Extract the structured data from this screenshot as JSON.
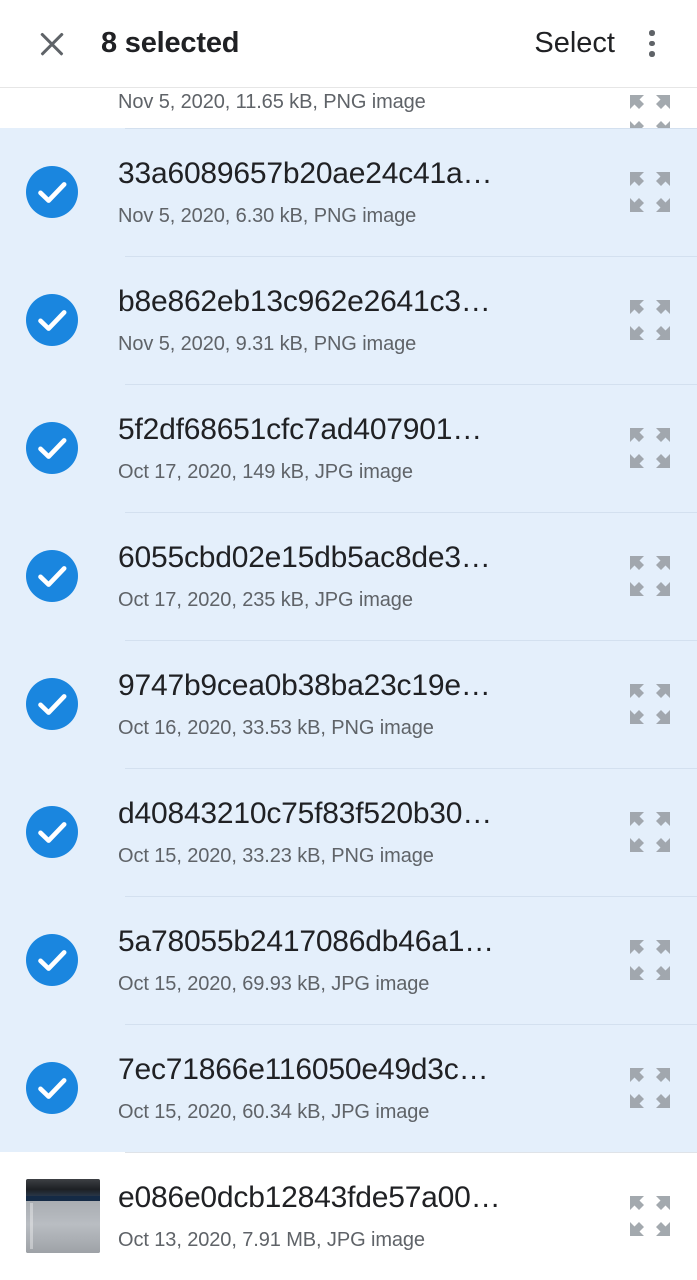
{
  "appbar": {
    "close_icon": "close-icon",
    "title": "8 selected",
    "select_label": "Select",
    "overflow_icon": "more-vert-icon"
  },
  "list": {
    "expand_icon": "expand-arrows-icon",
    "check_icon": "check-circle-icon",
    "rows": [
      {
        "name": "",
        "meta": "Nov 5, 2020, 11.65 kB, PNG image",
        "selected": false,
        "partial": true,
        "lead": "none"
      },
      {
        "name": "33a6089657b20ae24c41a…",
        "meta": "Nov 5, 2020, 6.30 kB, PNG image",
        "selected": true,
        "partial": false,
        "lead": "check"
      },
      {
        "name": "b8e862eb13c962e2641c3…",
        "meta": "Nov 5, 2020, 9.31 kB, PNG image",
        "selected": true,
        "partial": false,
        "lead": "check"
      },
      {
        "name": "5f2df68651cfc7ad407901…",
        "meta": "Oct 17, 2020, 149 kB, JPG image",
        "selected": true,
        "partial": false,
        "lead": "check"
      },
      {
        "name": "6055cbd02e15db5ac8de3…",
        "meta": "Oct 17, 2020, 235 kB, JPG image",
        "selected": true,
        "partial": false,
        "lead": "check"
      },
      {
        "name": "9747b9cea0b38ba23c19e…",
        "meta": "Oct 16, 2020, 33.53 kB, PNG image",
        "selected": true,
        "partial": false,
        "lead": "check"
      },
      {
        "name": "d40843210c75f83f520b30…",
        "meta": "Oct 15, 2020, 33.23 kB, PNG image",
        "selected": true,
        "partial": false,
        "lead": "check"
      },
      {
        "name": "5a78055b2417086db46a1…",
        "meta": "Oct 15, 2020, 69.93 kB, JPG image",
        "selected": true,
        "partial": false,
        "lead": "check"
      },
      {
        "name": "7ec71866e116050e49d3c…",
        "meta": "Oct 15, 2020, 60.34 kB, JPG image",
        "selected": true,
        "partial": false,
        "lead": "check"
      },
      {
        "name": "e086e0dcb12843fde57a00…",
        "meta": "Oct 13, 2020, 7.91 MB, JPG image",
        "selected": false,
        "partial": false,
        "lead": "thumbnail"
      }
    ]
  },
  "colors": {
    "selection_background": "#e4effb",
    "check_blue": "#1a86df",
    "primary_text": "#202124",
    "secondary_text": "#5f6368",
    "divider": "#dfe3e8"
  }
}
